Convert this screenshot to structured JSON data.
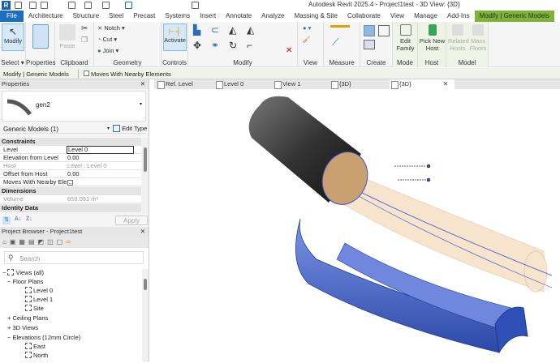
{
  "title": "Autodesk Revit 2025.4 - Project1test - 3D View: {3D}",
  "logo": "R",
  "tabs": [
    "File",
    "Architecture",
    "Structure",
    "Steel",
    "Precast",
    "Systems",
    "Insert",
    "Annotate",
    "Analyze",
    "Massing & Site",
    "Collaborate",
    "View",
    "Manage",
    "Add-Ins",
    "Modify | Generic Models"
  ],
  "ribbon": {
    "modify": "Modify",
    "select": "Select ▾",
    "properties": "Properties",
    "paste": "Paste",
    "clipboard": "Clipboard",
    "notch": "Notch ▾",
    "cut": "Cut ▾",
    "join": "Join ▾",
    "geometry": "Geometry",
    "activate": "Activate",
    "controls": "Controls",
    "modify_panel": "Modify",
    "view": "View",
    "measure": "Measure",
    "create": "Create",
    "edit_family": "Edit Family",
    "mode": "Mode",
    "pick_new_host": "Pick New Host",
    "host": "Host",
    "related_hosts": "Related Hosts",
    "mass_floors": "Mass Floors",
    "model": "Model"
  },
  "options_bar": {
    "context": "Modify | Generic Models",
    "moves_with": "Moves With Nearby Elements"
  },
  "properties": {
    "title": "Properties",
    "type_name": "gen2",
    "category": "Generic Models (1)",
    "edit_type": "Edit Type",
    "sections": {
      "constraints": "Constraints",
      "dimensions": "Dimensions",
      "identity": "Identity Data"
    },
    "rows": [
      {
        "k": "Level",
        "v": "Level 0"
      },
      {
        "k": "Elevation from Level",
        "v": "0.00"
      },
      {
        "k": "Host",
        "v": "Level : Level 0"
      },
      {
        "k": "Offset from Host",
        "v": "0.00"
      },
      {
        "k": "Moves With Nearby Ele...",
        "v": ""
      }
    ],
    "volume_label": "Volume",
    "volume": "659.091 m³",
    "apply": "Apply"
  },
  "browser": {
    "title": "Project Browser - Project1test",
    "search_placeholder": "Search",
    "items": [
      "Views (all)",
      "Floor Plans",
      "Level 0",
      "Level 1",
      "Site",
      "Ceiling Plans",
      "3D Views",
      "Elevations (12mm Circle)",
      "East",
      "North"
    ],
    "toggles": [
      "−",
      "−",
      "+",
      "+",
      "−"
    ]
  },
  "view_tabs": [
    "Ref. Level",
    "Level 0",
    "View 1",
    "{3D}",
    "{3D}"
  ],
  "colors": {
    "file": "#1b6fc2",
    "context_tab": "#7fb23a",
    "tan": "#f3d9b8",
    "blue": "#5b7ad6"
  }
}
